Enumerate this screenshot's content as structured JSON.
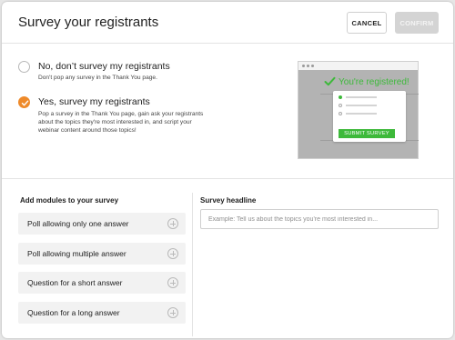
{
  "header": {
    "title": "Survey your registrants",
    "cancel_label": "CANCEL",
    "confirm_label": "CONFIRM"
  },
  "options": [
    {
      "title": "No, don’t survey my registrants",
      "description": "Don't pop any survey in the Thank You page.",
      "selected": false
    },
    {
      "title": "Yes, survey my registrants",
      "description_lines": [
        "Pop a survey in the Thank You page, gain ask your registrants",
        "about the topics they're most interested in, and script your",
        "webinar content around those topics!"
      ],
      "selected": true
    }
  ],
  "preview": {
    "registered_text": "You're registered!",
    "submit_label": "SUBMIT SURVEY"
  },
  "modules": {
    "heading": "Add modules to your survey",
    "items": [
      "Poll allowing only one answer",
      "Poll allowing multiple answer",
      "Question for a short answer",
      "Question for a long answer"
    ]
  },
  "headline": {
    "label": "Survey headline",
    "placeholder": "Example: Tell us about the topics you're most interested in..."
  },
  "colors": {
    "accent": "#ee8a2a",
    "success": "#3db93a",
    "confirm_disabled": "#d4d4d4"
  }
}
